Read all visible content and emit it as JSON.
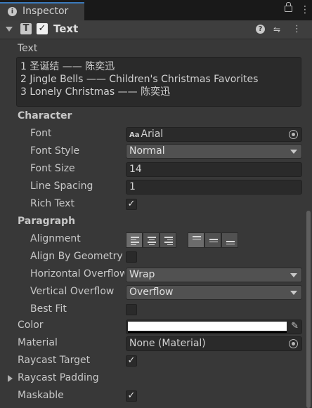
{
  "window": {
    "tab_title": "Inspector"
  },
  "component": {
    "title": "Text",
    "icon": "text-component-icon",
    "enabled": true
  },
  "text_field": {
    "label": "Text",
    "lines": [
      "1 圣诞结 —— 陈奕迅",
      "2 Jingle Bells —— Children's Christmas Favorites",
      "3 Lonely Christmas —— 陈奕迅"
    ]
  },
  "character": {
    "heading": "Character",
    "font_label": "Font",
    "font_value": "Arial",
    "font_style_label": "Font Style",
    "font_style_value": "Normal",
    "font_size_label": "Font Size",
    "font_size_value": "14",
    "line_spacing_label": "Line Spacing",
    "line_spacing_value": "1",
    "rich_text_label": "Rich Text",
    "rich_text_checked": true
  },
  "paragraph": {
    "heading": "Paragraph",
    "alignment_label": "Alignment",
    "align_geometry_label": "Align By Geometry",
    "align_geometry_checked": false,
    "h_overflow_label": "Horizontal Overflow",
    "h_overflow_value": "Wrap",
    "v_overflow_label": "Vertical Overflow",
    "v_overflow_value": "Overflow",
    "best_fit_label": "Best Fit",
    "best_fit_checked": false
  },
  "color": {
    "label": "Color",
    "value": "#ffffff"
  },
  "material": {
    "label": "Material",
    "value": "None (Material)"
  },
  "raycast_target": {
    "label": "Raycast Target",
    "checked": true
  },
  "raycast_padding": {
    "label": "Raycast Padding"
  },
  "maskable": {
    "label": "Maskable",
    "checked": true
  },
  "check_mark": "✓"
}
